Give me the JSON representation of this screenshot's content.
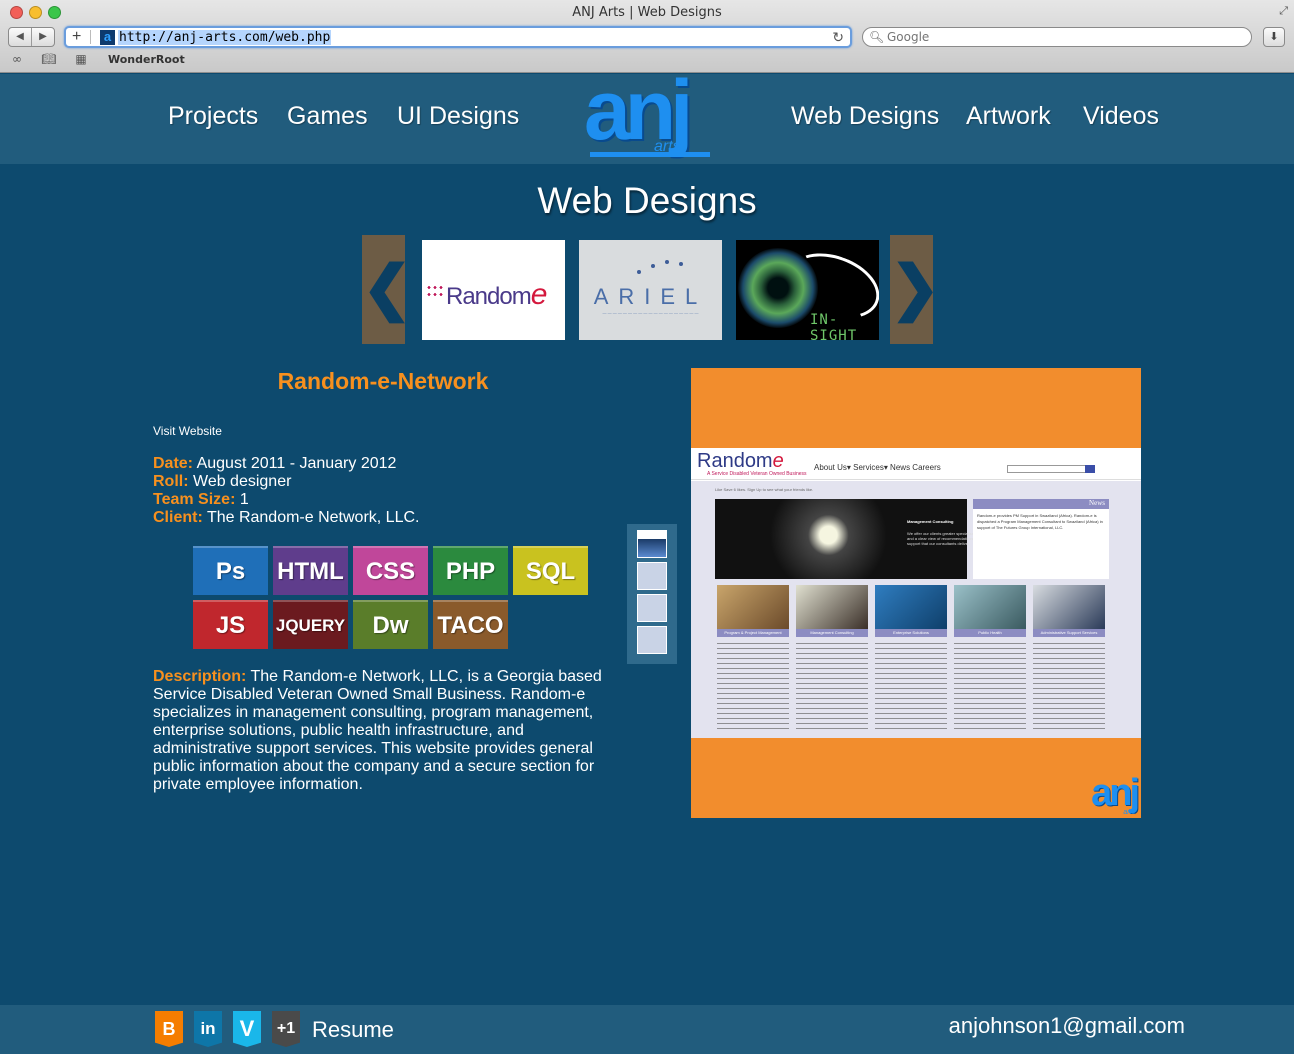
{
  "browser": {
    "window_title": "ANJ Arts | Web Designs",
    "url": "http://anj-arts.com/web.php",
    "search_placeholder": "Google",
    "bookmark": "WonderRoot"
  },
  "nav": {
    "left": [
      "Projects",
      "Games",
      "UI Designs"
    ],
    "right": [
      "Web Designs",
      "Artwork",
      "Videos"
    ],
    "logo_main": "anj",
    "logo_sub": "arts"
  },
  "page_title": "Web Designs",
  "carousel": {
    "prev": "❮",
    "next": "❯",
    "thumbs": [
      {
        "name": "Random",
        "label": "Random",
        "accent": "e"
      },
      {
        "name": "ARIEL",
        "label": "ARIEL"
      },
      {
        "name": "IN-SIGHT",
        "label": "IN-SIGHT"
      }
    ]
  },
  "project": {
    "title": "Random-e-Network",
    "visit": "Visit Website",
    "date_label": "Date:",
    "date": "August 2011 - January 2012",
    "roll_label": "Roll:",
    "roll": "Web designer",
    "team_label": "Team Size:",
    "team": "1",
    "client_label": "Client:",
    "client": "The Random-e Network, LLC.",
    "skills": [
      {
        "label": "Ps",
        "color": "#1f6fb8"
      },
      {
        "label": "HTML",
        "color": "#5f3d8c"
      },
      {
        "label": "CSS",
        "color": "#c0479a"
      },
      {
        "label": "PHP",
        "color": "#2b8a3e"
      },
      {
        "label": "SQL",
        "color": "#c9c21f"
      },
      {
        "label": "JS",
        "color": "#c0272d"
      },
      {
        "label": "JQUERY",
        "color": "#6b1a1f"
      },
      {
        "label": "Dw",
        "color": "#5a7d2a"
      },
      {
        "label": "TACO",
        "color": "#8a5a2b"
      }
    ],
    "desc_label": "Description:",
    "description": "The Random-e Network, LLC, is a Georgia based Service Disabled Veteran Owned Small Business. Random-e specializes in management consulting, program management, enterprise solutions, public health infrastructure, and administrative support services. This website provides general public information about the company and a secure section for private employee information."
  },
  "preview": {
    "logo": "Random",
    "logo_accent": "e",
    "tagline": "A Service Disabled Veteran Owned Business",
    "nav": "About Us▾  Services▾  News  Careers",
    "hero_title": "Management Consulting",
    "hero_text": "We offer our clients greater specialization and a clear view of recommendations and support that our consultants deliver.",
    "news_title": "News",
    "news_text": "Random-e provides PM Support in Swaziland (Africa). Random-e is dispatched a Program Management Consultant to Swaziland (Africa) in support of The Futures Group International, LLC.",
    "strip": "Like  Save  6 likes. Sign Up to see what your friends like.",
    "captions": [
      "Program & Project Management",
      "Management Consulting",
      "Enterprise Solutions",
      "Public Health",
      "Administrative Support Services"
    ],
    "corner_logo": "anj",
    "corner_logo_sub": "arts"
  },
  "footer": {
    "blogger": "B",
    "linkedin": "in",
    "vimeo": "V",
    "gplus": "+1",
    "resume": "Resume",
    "email": "anjohnson1@gmail.com"
  }
}
